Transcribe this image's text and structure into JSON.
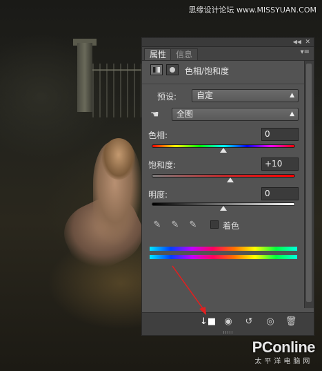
{
  "watermark": {
    "top": "思缘设计论坛 www.MISSYUAN.COM",
    "logo": "PConline",
    "logo_sub": "太平洋电脑网"
  },
  "panel": {
    "tabs": [
      {
        "label": "属性",
        "active": true
      },
      {
        "label": "信息",
        "active": false
      }
    ],
    "title": "色相/饱和度",
    "preset_label": "预设:",
    "preset_value": "自定",
    "channel_value": "全图",
    "hue": {
      "label": "色相:",
      "value": "0",
      "level": 0
    },
    "saturation": {
      "label": "饱和度:",
      "value": "+10",
      "level": 10
    },
    "lightness": {
      "label": "明度:",
      "value": "0",
      "level": 0
    },
    "colorize_label": "着色",
    "colorize_checked": false
  },
  "icons": {
    "titlebar": [
      "collapse-icon",
      "close-icon"
    ],
    "header": [
      "adjustment-layer-icon",
      "mask-icon"
    ],
    "eyedroppers": [
      "eyedropper-icon",
      "eyedropper-plus-icon",
      "eyedropper-minus-icon"
    ],
    "bottom": [
      "clip-to-layer-icon",
      "view-previous-state-icon",
      "reset-icon",
      "visibility-icon",
      "delete-icon"
    ]
  },
  "colors": {
    "panel_bg": "#535353",
    "annotation_arrow": "#e02020"
  }
}
